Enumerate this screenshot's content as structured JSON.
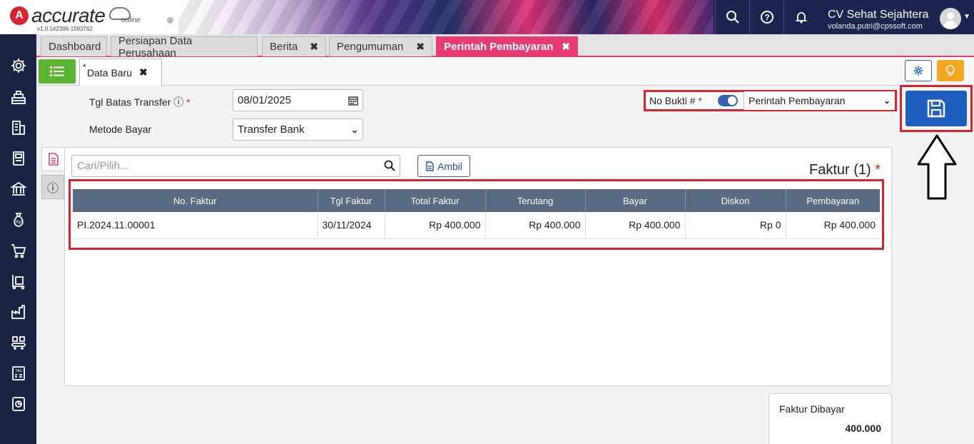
{
  "app": {
    "logo_text": "accurate",
    "logo_sub": "online",
    "version": "v1.0.1#2396-1593762",
    "company": "CV Sehat Sejahtera",
    "email": "volanda.putri@cpssoft.com"
  },
  "tabs": [
    {
      "label": "Dashboard",
      "closable": false
    },
    {
      "label": "Persiapan Data Perusahaan",
      "closable": false
    },
    {
      "label": "Berita",
      "closable": true
    },
    {
      "label": "Pengumuman",
      "closable": true
    },
    {
      "label": "Perintah Pembayaran",
      "closable": true,
      "active": true
    }
  ],
  "tab_count": "5",
  "subtab": {
    "star": "*",
    "label": "Data Baru"
  },
  "form": {
    "tgl_label": "Tgl Batas Transfer",
    "tgl_value": "08/01/2025",
    "metode_label": "Metode Bayar",
    "metode_value": "Transfer Bank",
    "nobukti_label": "No Bukti #",
    "nobukti_value": "Perintah Pembayaran",
    "required_mark": "*"
  },
  "search": {
    "placeholder": "Cari/Pilih..."
  },
  "ambil_label": "Ambil",
  "faktur_title": "Faktur (1)",
  "table": {
    "headers": [
      "No. Faktur",
      "Tgl Faktur",
      "Total Faktur",
      "Terutang",
      "Bayar",
      "Diskon",
      "Pembayaran"
    ],
    "rows": [
      [
        "PI.2024.11.00001",
        "30/11/2024",
        "Rp 400.000",
        "Rp 400.000",
        "Rp 400.000",
        "Rp 0",
        "Rp 400.000"
      ]
    ]
  },
  "summary": {
    "label": "Faktur Dibayar",
    "value": "400.000"
  },
  "colors": {
    "accent": "#e63b73",
    "sidebar": "#1b2345",
    "highlight": "#d8232e",
    "primary": "#1f5fbf"
  }
}
